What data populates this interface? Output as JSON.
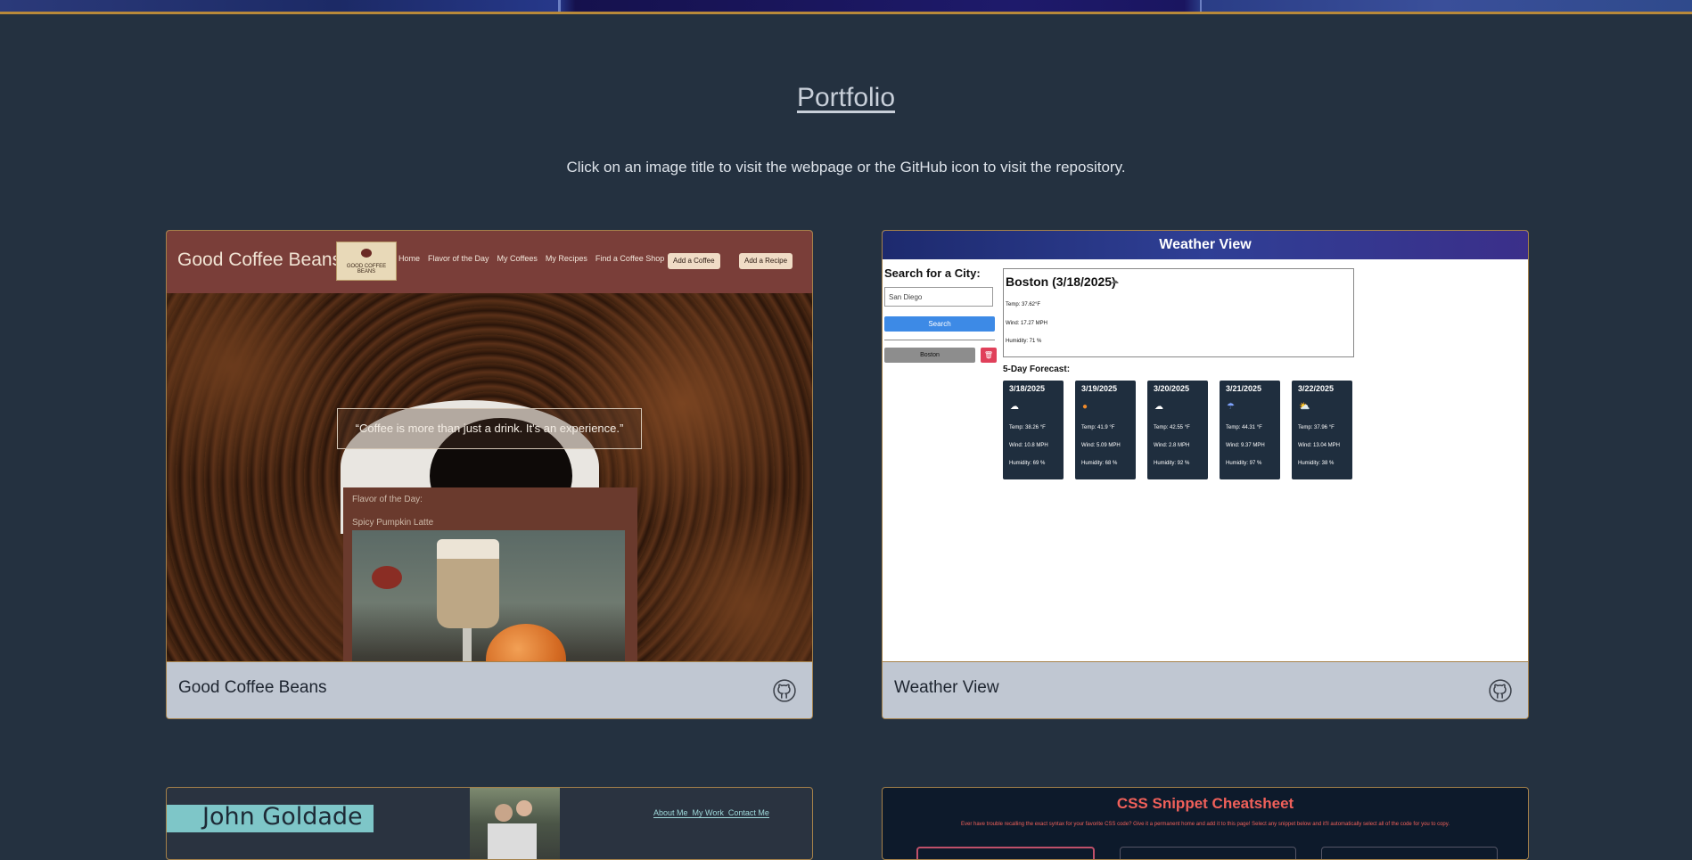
{
  "page": {
    "title": "Portfolio",
    "subtitle": "Click on an image title to visit the webpage or the GitHub icon to visit the repository."
  },
  "projects": [
    {
      "title": "Good Coffee Beans",
      "icon": "github-icon",
      "screenshot": {
        "brand": "Good Coffee Beans",
        "logo_text": "GOOD COFFEE BEANS",
        "nav_links": [
          "Home",
          "Flavor of the Day",
          "My Coffees",
          "My Recipes",
          "Find a Coffee Shop"
        ],
        "buttons": [
          "Add a Coffee",
          "Add a Recipe"
        ],
        "quote": "“Coffee is more than just a drink. It's an experience.”",
        "flavor_label": "Flavor of the Day:",
        "flavor_name": "Spicy Pumpkin Latte"
      }
    },
    {
      "title": "Weather View",
      "icon": "github-icon",
      "screenshot": {
        "header": "Weather View",
        "search_label": "Search for a City:",
        "search_value": "San Diego",
        "search_button": "Search",
        "history": [
          "Boston"
        ],
        "current": {
          "city": "Boston (3/18/2025)",
          "temp": "Temp: 37.62°F",
          "wind": "Wind: 17.27 MPH",
          "humidity": "Humidity: 71 %"
        },
        "forecast_label": "5-Day Forecast:",
        "forecast": [
          {
            "date": "3/18/2025",
            "icon": "cloud-icon",
            "temp": "Temp: 38.26 °F",
            "wind": "Wind: 10.8 MPH",
            "humidity": "Humidity: 69 %"
          },
          {
            "date": "3/19/2025",
            "icon": "sun-icon",
            "temp": "Temp: 41.9 °F",
            "wind": "Wind: 5.09 MPH",
            "humidity": "Humidity: 68 %"
          },
          {
            "date": "3/20/2025",
            "icon": "cloud-icon",
            "temp": "Temp: 42.55 °F",
            "wind": "Wind: 2.8 MPH",
            "humidity": "Humidity: 92 %"
          },
          {
            "date": "3/21/2025",
            "icon": "rain-icon",
            "temp": "Temp: 44.31 °F",
            "wind": "Wind: 9.37 MPH",
            "humidity": "Humidity: 97 %"
          },
          {
            "date": "3/22/2025",
            "icon": "partly-cloudy-icon",
            "temp": "Temp: 37.96 °F",
            "wind": "Wind: 13.04 MPH",
            "humidity": "Humidity: 38 %"
          }
        ]
      }
    },
    {
      "title": "John Goldade",
      "screenshot": {
        "name": "John Goldade",
        "nav_links": [
          "About Me",
          "My Work",
          "Contact Me"
        ]
      }
    },
    {
      "title": "CSS Snippet Cheatsheet",
      "screenshot": {
        "heading": "CSS Snippet Cheatsheet",
        "description": "Ever have trouble recalling the exact syntax for your favorite CSS code? Give it a permanent home and add it to this page! Select any snippet below and it'll automatically select all of the code for you to copy."
      }
    }
  ],
  "colors": {
    "background": "#243140",
    "card_footer": "#c0c7d2",
    "card_border": "#a5814a",
    "heading": "#c8cfd9"
  }
}
